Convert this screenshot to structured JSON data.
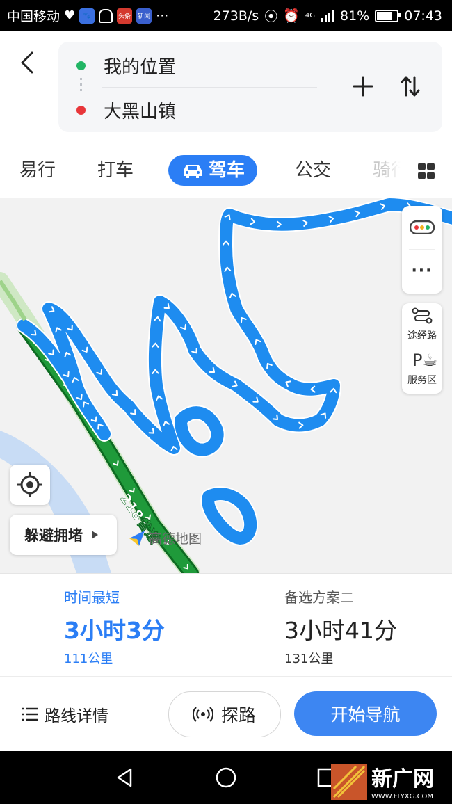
{
  "status_bar": {
    "carrier": "中国移动",
    "app_icons": [
      {
        "name": "heart-icon",
        "color": "#ffffff"
      },
      {
        "name": "baidu-icon",
        "color": "#3b70e0"
      },
      {
        "name": "ghost-icon",
        "color": "#ffffff"
      },
      {
        "name": "toutiao-icon",
        "color": "#d43a2f",
        "text": "头条"
      },
      {
        "name": "news-icon",
        "color": "#3a5fcd",
        "text": "新闻"
      }
    ],
    "more": "···",
    "net_speed": "273B/s",
    "signal": "4G",
    "battery_percent": "81%",
    "battery_level": 0.81,
    "time": "07:43"
  },
  "route": {
    "start": "我的位置",
    "end": "大黑山镇",
    "start_color": "#22b565",
    "end_color": "#e8363a"
  },
  "tabs": [
    {
      "label": "易行",
      "active": false
    },
    {
      "label": "打车",
      "active": false
    },
    {
      "label": "驾车",
      "active": true
    },
    {
      "label": "公交",
      "active": false
    },
    {
      "label": "骑行",
      "active": false
    }
  ],
  "map": {
    "road_label": "218省道",
    "logo_text": "高德地图",
    "side_tools": [
      {
        "name": "traffic",
        "label": ""
      },
      {
        "name": "more",
        "label": ""
      },
      {
        "name": "waypoint",
        "label": "途经路"
      },
      {
        "name": "service-area",
        "label": "服务区"
      }
    ],
    "avoid_label": "躲避拥堵",
    "route_color": "#1e8cf0",
    "highway_color": "#1f9a3a"
  },
  "plans": [
    {
      "name": "时间最短",
      "time": "3小时3分",
      "distance": "111公里",
      "selected": true
    },
    {
      "name": "备选方案二",
      "time": "3小时41分",
      "distance": "131公里",
      "selected": false
    }
  ],
  "actions": {
    "details": "路线详情",
    "explore": "探路",
    "navigate": "开始导航"
  },
  "watermark": {
    "text": "新广网",
    "url": "WWW.FLYXG.COM"
  }
}
